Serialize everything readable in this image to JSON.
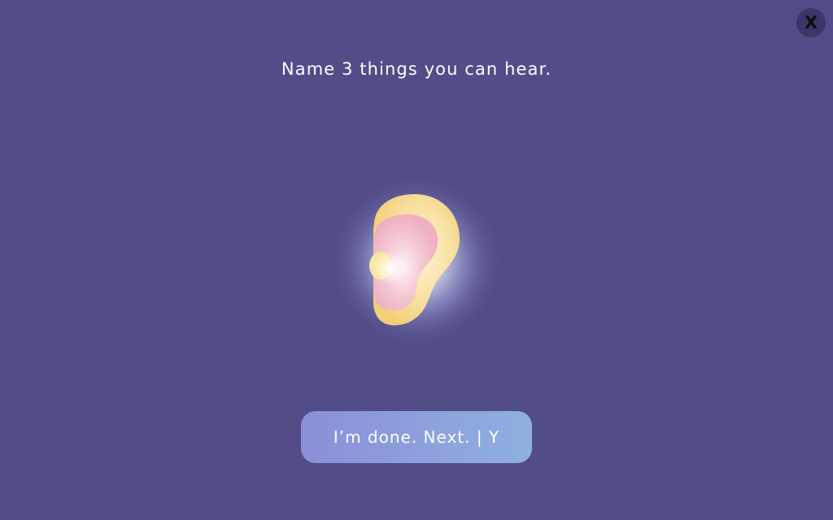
{
  "close": {
    "label": "X"
  },
  "prompt": {
    "text": "Name 3 things you can hear."
  },
  "illustration": {
    "icon": "ear-icon",
    "colors": {
      "outer": "#f5d98a",
      "inner": "#f0b8c6",
      "glow": "#ffffff",
      "background": "#524c88"
    }
  },
  "next_button": {
    "label": "I’m done. Next. | Y"
  }
}
